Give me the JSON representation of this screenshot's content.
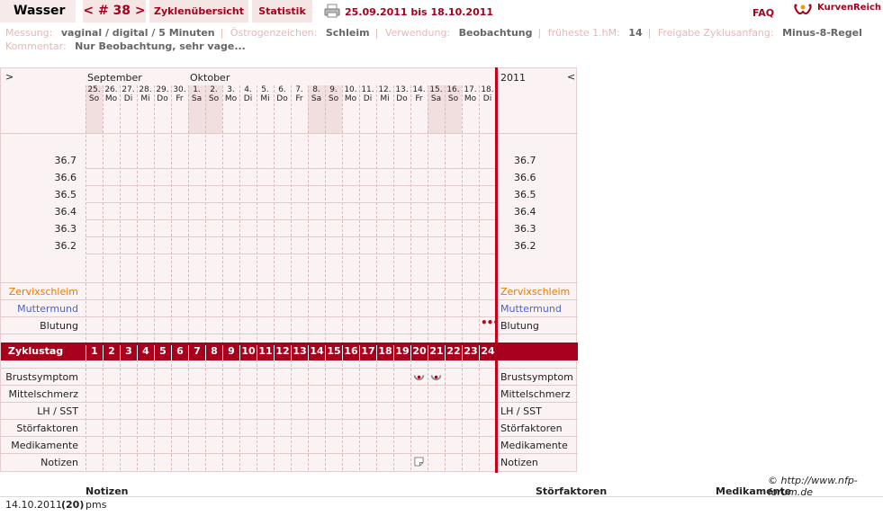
{
  "header": {
    "title": "Wasser",
    "cycle_label": "< # 38 >",
    "tabs": [
      "Zyklenübersicht",
      "Statistik"
    ],
    "date_range": "25.09.2011 bis 18.10.2011",
    "faq": "FAQ",
    "logo": "KurvenReich",
    "accent_color": "#a8001c"
  },
  "meta": {
    "messung_label": "Messung:",
    "messung_value": "vaginal / digital / 5 Minuten",
    "oestrogen_label": "Östrogenzeichen:",
    "oestrogen_value": "Schleim",
    "verwendung_label": "Verwendung:",
    "verwendung_value": "Beobachtung",
    "fhm_label": "früheste 1.hM:",
    "fhm_value": "14",
    "freigabe_label": "Freigabe Zyklusanfang:",
    "freigabe_value": "Minus-8-Regel",
    "kommentar_label": "Kommentar:",
    "kommentar_value": "Nur Beobachtung, sehr vage..."
  },
  "chart": {
    "nav_left": ">",
    "nav_right": "<",
    "year": "2011",
    "months": [
      {
        "name": "September",
        "day_index": 0
      },
      {
        "name": "Oktober",
        "day_index": 6
      }
    ],
    "days": [
      {
        "d": "25.",
        "w": "So",
        "we": true
      },
      {
        "d": "26.",
        "w": "Mo",
        "we": false
      },
      {
        "d": "27.",
        "w": "Di",
        "we": false
      },
      {
        "d": "28.",
        "w": "Mi",
        "we": false
      },
      {
        "d": "29.",
        "w": "Do",
        "we": false
      },
      {
        "d": "30.",
        "w": "Fr",
        "we": false
      },
      {
        "d": "1.",
        "w": "Sa",
        "we": true
      },
      {
        "d": "2.",
        "w": "So",
        "we": true
      },
      {
        "d": "3.",
        "w": "Mo",
        "we": false
      },
      {
        "d": "4.",
        "w": "Di",
        "we": false
      },
      {
        "d": "5.",
        "w": "Mi",
        "we": false
      },
      {
        "d": "6.",
        "w": "Do",
        "we": false
      },
      {
        "d": "7.",
        "w": "Fr",
        "we": false
      },
      {
        "d": "8.",
        "w": "Sa",
        "we": true
      },
      {
        "d": "9.",
        "w": "So",
        "we": true
      },
      {
        "d": "10.",
        "w": "Mo",
        "we": false
      },
      {
        "d": "11.",
        "w": "Di",
        "we": false
      },
      {
        "d": "12.",
        "w": "Mi",
        "we": false
      },
      {
        "d": "13.",
        "w": "Do",
        "we": false
      },
      {
        "d": "14.",
        "w": "Fr",
        "we": false
      },
      {
        "d": "15.",
        "w": "Sa",
        "we": true
      },
      {
        "d": "16.",
        "w": "So",
        "we": true
      },
      {
        "d": "17.",
        "w": "Mo",
        "we": false
      },
      {
        "d": "18.",
        "w": "Di",
        "we": false
      }
    ],
    "temperatures": [
      "36.7",
      "36.6",
      "36.5",
      "36.4",
      "36.3",
      "36.2"
    ],
    "rows_top": [
      {
        "label": "Zervixschleim",
        "color": "#e87a00"
      },
      {
        "label": "Muttermund",
        "color": "#4a5fd0"
      },
      {
        "label": "Blutung",
        "color": "#222222"
      }
    ],
    "zyklustag_label": "Zyklustag",
    "cycle_days": [
      "1",
      "2",
      "3",
      "4",
      "5",
      "6",
      "7",
      "8",
      "9",
      "10",
      "11",
      "12",
      "13",
      "14",
      "15",
      "16",
      "17",
      "18",
      "19",
      "20",
      "21",
      "22",
      "23",
      "24"
    ],
    "rows_bottom": [
      "Brustsymptom",
      "Mittelschmerz",
      "LH / SST",
      "Störfaktoren",
      "Medikamente",
      "Notizen"
    ],
    "markers": {
      "blutung_day_index": 23,
      "brust_day_indices": [
        19,
        20
      ],
      "notiz_day_index": 19,
      "bleeding_color": "#c8001c"
    }
  },
  "footer": {
    "copyright": "© http://www.nfp-forum.de",
    "headers": [
      "Notizen",
      "Störfaktoren",
      "Medikamente"
    ],
    "rows": [
      {
        "date": "14.10.2011",
        "day": "(20)",
        "note": "pms"
      }
    ]
  }
}
